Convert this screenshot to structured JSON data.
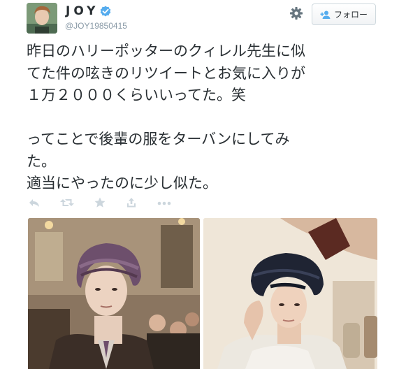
{
  "user": {
    "name": "JOY",
    "handle": "@JOY19850415"
  },
  "follow_button": {
    "label": "フォロー"
  },
  "tweet": {
    "lines": [
      "昨日のハリーポッターのクィレル先生に似",
      "てた件の呟きのリツイートとお気に入りが",
      "１万２０００くらいいってた。笑",
      "",
      "ってことで後輩の服をターバンにしてみ",
      "た。",
      "適当にやったのに少し似た。"
    ]
  },
  "actions": [
    {
      "icon": "reply-icon"
    },
    {
      "icon": "retweet-icon"
    },
    {
      "icon": "favorite-star-icon"
    },
    {
      "icon": "share-icon"
    },
    {
      "icon": "more-icon"
    }
  ],
  "colors": {
    "text": "#292f33",
    "muted": "#8899a6",
    "verified": "#55acee",
    "icon": "#ccd6dd"
  },
  "photos": [
    {
      "subject": "turban-portrait-left"
    },
    {
      "subject": "turban-portrait-right"
    }
  ]
}
